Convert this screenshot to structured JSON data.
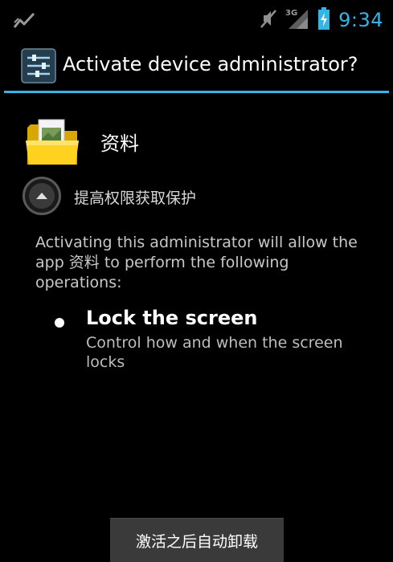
{
  "status_bar": {
    "time": "9:34",
    "network_type": "3G",
    "icons": [
      "activity-icon",
      "mute-icon",
      "signal-icon",
      "battery-charging-icon"
    ],
    "accent_color": "#33b5e5"
  },
  "title_bar": {
    "title": "Activate device administrator?",
    "icon": "settings-sliders-icon"
  },
  "app": {
    "name": "资料",
    "icon": "folder-icon"
  },
  "expand": {
    "label": "提高权限获取保护",
    "icon": "chevron-up-icon"
  },
  "description": "Activating this administrator will allow the app 资料 to perform the following operations:",
  "policy": {
    "title": "Lock the screen",
    "description": "Control how and when the screen locks"
  },
  "button": {
    "label": "激活之后自动卸载"
  }
}
